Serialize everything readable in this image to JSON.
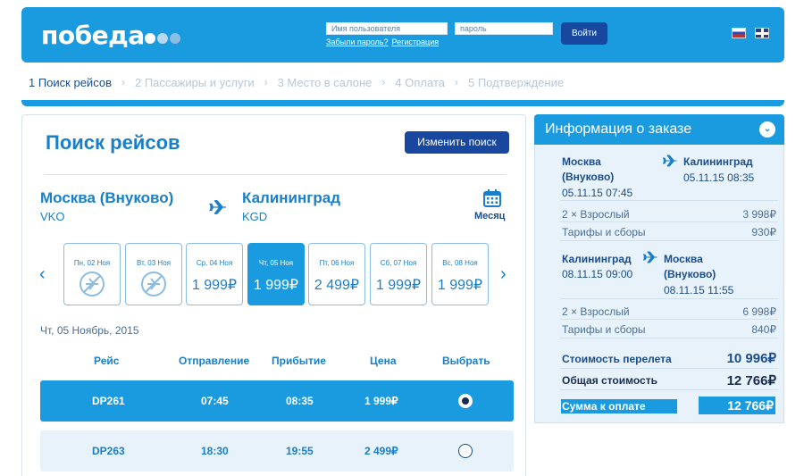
{
  "header": {
    "logo_text": "победа",
    "username_placeholder": "Имя пользователя",
    "password_placeholder": "пароль",
    "forgot_link": "Забыли пароль?",
    "register_link": "Регистрация",
    "login_button": "Войти",
    "colors": {
      "brand": "#1a9be0",
      "button": "#17479e"
    }
  },
  "steps": [
    {
      "label": "1 Поиск рейсов",
      "active": true
    },
    {
      "label": "2 Пассажиры и услуги",
      "active": false
    },
    {
      "label": "3 Место в салоне",
      "active": false
    },
    {
      "label": "4 Оплата",
      "active": false
    },
    {
      "label": "5 Подтверждение",
      "active": false
    }
  ],
  "search": {
    "title": "Поиск рейсов",
    "change_button": "Изменить поиск",
    "from_city": "Москва (Внуково)",
    "from_code": "VKO",
    "to_city": "Калининград",
    "to_code": "KGD",
    "month_label": "Месяц",
    "dates": [
      {
        "label": "Пн, 02 Ноя",
        "price": null
      },
      {
        "label": "Вт, 03 Ноя",
        "price": null
      },
      {
        "label": "Ср, 04 Ноя",
        "price": "1 999₽"
      },
      {
        "label": "Чт, 05 Ноя",
        "price": "1 999₽",
        "selected": true
      },
      {
        "label": "Пт, 06 Ноя",
        "price": "2 499₽"
      },
      {
        "label": "Сб, 07 Ноя",
        "price": "1 999₽"
      },
      {
        "label": "Вс, 08 Ноя",
        "price": "1 999₽"
      }
    ],
    "selected_date": "Чт, 05 Ноябрь, 2015",
    "columns": [
      "Рейс",
      "Отправление",
      "Прибытие",
      "Цена",
      "Выбрать"
    ],
    "flights": [
      {
        "flight": "DP261",
        "depart": "07:45",
        "arrive": "08:35",
        "price": "1 999₽",
        "selected": true
      },
      {
        "flight": "DP263",
        "depart": "18:30",
        "arrive": "19:55",
        "price": "2 499₽",
        "selected": false
      }
    ]
  },
  "order": {
    "title": "Информация о заказе",
    "outbound": {
      "from_line1": "Москва",
      "from_line2": "(Внуково)",
      "from_time": "05.11.15 07:45",
      "to": "Калининград",
      "to_time": "05.11.15 08:35",
      "pax_label": "2 × Взрослый",
      "pax_price": "3 998₽",
      "fees_label": "Тарифы и сборы",
      "fees_price": "930₽"
    },
    "return": {
      "from": "Калининград",
      "from_time": "08.11.15 09:00",
      "to_line1": "Москва",
      "to_line2": "(Внуково)",
      "to_time": "08.11.15 11:55",
      "pax_label": "2 × Взрослый",
      "pax_price": "6 998₽",
      "fees_label": "Тарифы и сборы",
      "fees_price": "840₽"
    },
    "flight_cost_label": "Стоимость перелета",
    "flight_cost": "10 996₽",
    "total_label": "Общая стоимость",
    "total": "12 766₽",
    "payable_label": "Сумма к оплате",
    "payable": "12 766₽"
  }
}
